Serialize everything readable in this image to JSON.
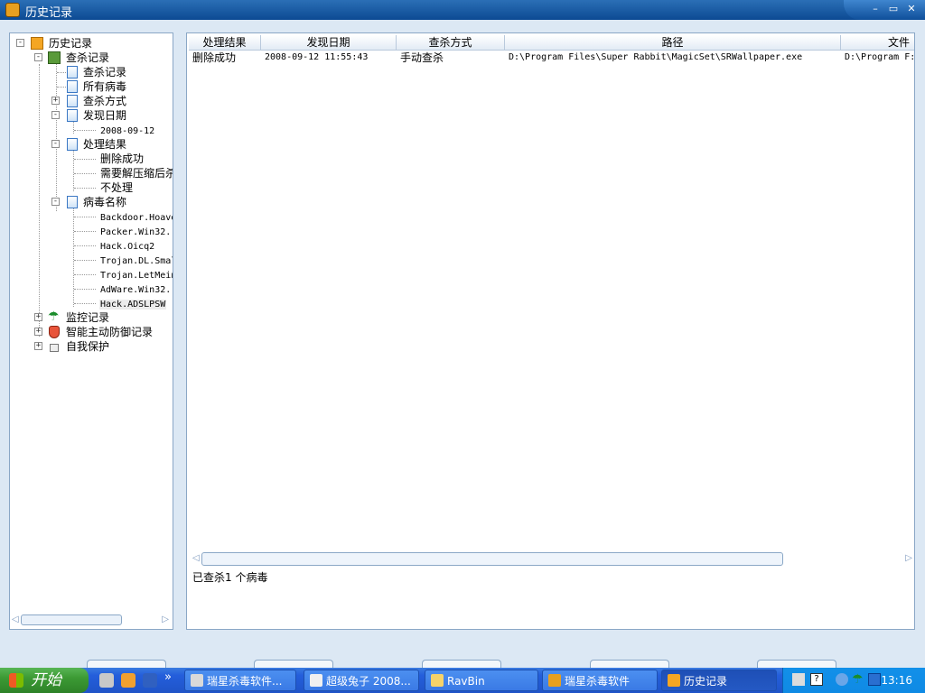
{
  "window": {
    "title": "历史记录",
    "minimize_label": "–",
    "restore_label": "▭",
    "close_label": "✕"
  },
  "tree": {
    "root": "历史记录",
    "scan_records": "查杀记录",
    "items": {
      "scan_record": "查杀记录",
      "all_viruses": "所有病毒",
      "scan_method": "查杀方式",
      "found_date": "发现日期",
      "found_date_child": "2008-09-12",
      "result": "处理结果",
      "result_deleted": "删除成功",
      "result_need_unzip": "需要解压缩后杀",
      "result_none": "不处理",
      "virus_name": "病毒名称",
      "virus_1": "Backdoor.Hoave",
      "virus_2": "Packer.Win32.",
      "virus_3": "Hack.Oicq2",
      "virus_4": "Trojan.DL.Smal",
      "virus_5": "Trojan.LetMein",
      "virus_6": "AdWare.Win32.",
      "virus_7": "Hack.ADSLPSW"
    },
    "monitor_records": "监控记录",
    "defense_records": "智能主动防御记录",
    "self_protect": "自我保护"
  },
  "list": {
    "columns": [
      "处理结果",
      "发现日期",
      "查杀方式",
      "路径",
      "文件"
    ],
    "rows": [
      {
        "result": "删除成功",
        "date": "2008-09-12 11:55:43",
        "method": "手动查杀",
        "path": "D:\\Program Files\\Super Rabbit\\MagicSet\\SRWallpaper.exe",
        "file": "D:\\Program F:"
      }
    ]
  },
  "status": "已查杀1 个病毒",
  "taskbar": {
    "start_label": "开始",
    "more_label": "»",
    "tasks": [
      {
        "label": "瑞星杀毒软件...",
        "icon": "rising-icon",
        "color": "#d9d9d9"
      },
      {
        "label": "超级兔子 2008...",
        "icon": "rabbit-icon",
        "color": "#f0f0f0"
      },
      {
        "label": "RavBin",
        "icon": "folder-icon",
        "color": "#f6d36a"
      },
      {
        "label": "瑞星杀毒软件",
        "icon": "rising-icon",
        "color": "#e8a020"
      },
      {
        "label": "历史记录",
        "icon": "history-icon",
        "color": "#f4a623"
      }
    ],
    "clock": "13:16",
    "colors": {
      "taskbar": "#245edb",
      "start": "#3c9a34",
      "tray": "#0f8ae4"
    }
  }
}
